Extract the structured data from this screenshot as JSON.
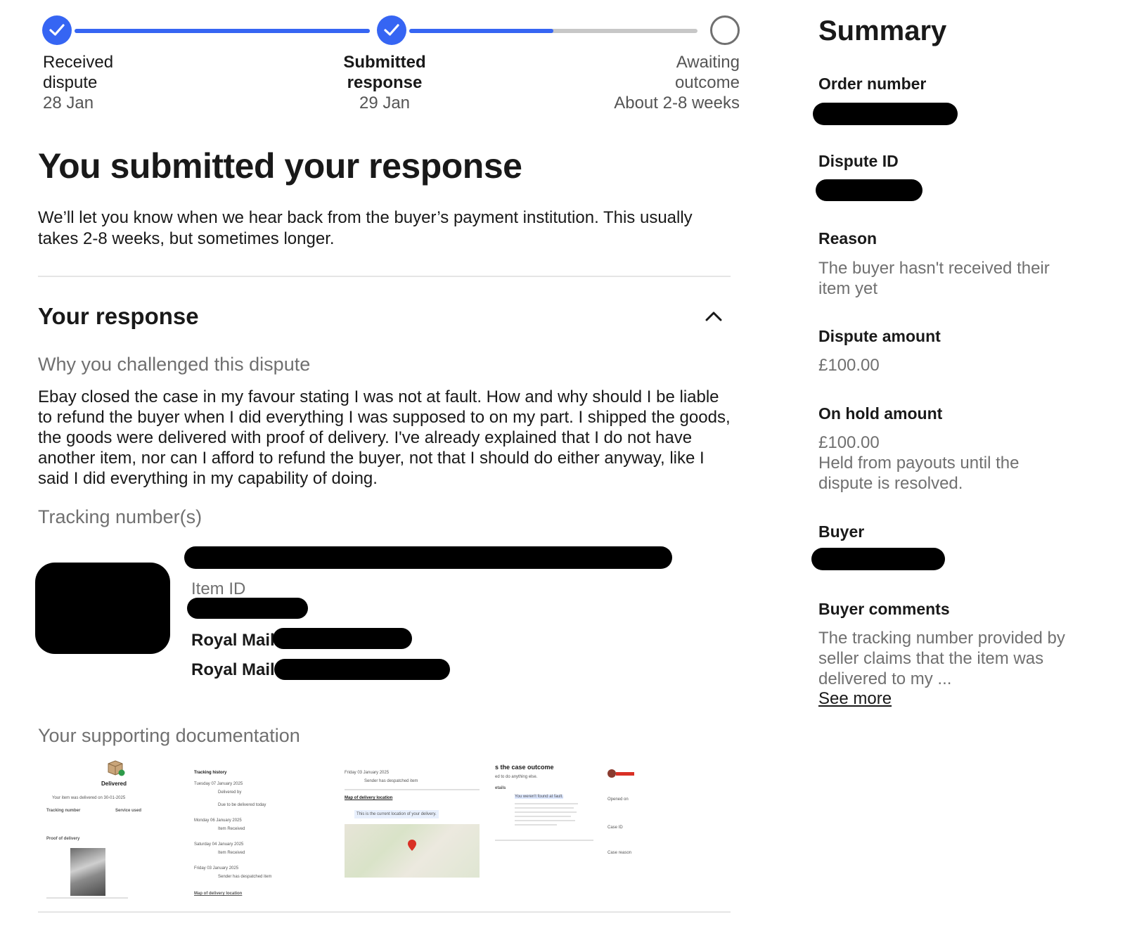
{
  "colors": {
    "accent": "#3665f3",
    "pending": "#707070",
    "redaction": "#000000"
  },
  "stepper": {
    "progress_fraction": 0.5,
    "steps": [
      {
        "name": "Received dispute",
        "date": "28 Jan",
        "state": "done"
      },
      {
        "name": "Submitted response",
        "date": "29 Jan",
        "state": "current"
      },
      {
        "name": "Awaiting outcome",
        "date": "About 2-8 weeks",
        "state": "pending"
      }
    ]
  },
  "main": {
    "title": "You submitted your response",
    "intro": "We’ll let you know when we hear back from the buyer’s payment institution. This usually takes 2-8 weeks, but sometimes longer.",
    "response_section": {
      "title": "Your response",
      "toggle_icon": "chevron-up-icon",
      "why_label": "Why you challenged this dispute",
      "why_text": "Ebay closed the case in my favour stating I was not at fault. How and why should I be liable to refund the buyer when I did everything I was supposed to on my part. I shipped the goods, the goods were delivered with proof of delivery. I've already explained that I do not have another item, nor can I afford to refund the buyer, not that I should do either anyway, like I said I did everything in my capability of doing.",
      "tracking_label": "Tracking number(s)",
      "item_id_label": "Item ID",
      "carriers": [
        "Royal Mail",
        "Royal Mail"
      ],
      "docs_label": "Your supporting documentation",
      "docs": {
        "d1": {
          "status": "Delivered",
          "icon": "parcel-icon",
          "line1": "Your item was delivered on 30-01-2025",
          "tracking": "Tracking number",
          "service": "Service used",
          "proof": "Proof of delivery"
        },
        "d2": {
          "heading": "Tracking history",
          "rows": [
            "Tuesday 07 January 2025",
            "Delivered by",
            "Due to be delivered today",
            "Monday 06 January 2025",
            "Item Received",
            "Saturday 04 January 2025",
            "Item Received",
            "Friday 03 January 2025",
            "Sender has despatched item"
          ],
          "footer": "Map of delivery location"
        },
        "d3": {
          "heading": "Map of delivery location",
          "note": "This is the current location of your delivery.",
          "top": "Friday 03 January 2025",
          "sub": "Sender has despatched item",
          "icon": "map-pin-icon"
        },
        "d4": {
          "heading": "s the case outcome",
          "sub": "ed to do anything else.",
          "label": "etails",
          "highlight": "You weren't found at fault."
        },
        "d5": {
          "label": "Opened on",
          "case": "Case ID",
          "reason": "Case reason"
        }
      }
    }
  },
  "summary": {
    "title": "Summary",
    "order_number_label": "Order number",
    "dispute_id_label": "Dispute ID",
    "reason_label": "Reason",
    "reason_value": "The buyer hasn't received their item yet",
    "dispute_amount_label": "Dispute amount",
    "dispute_amount_value": "£100.00",
    "on_hold_label": "On hold amount",
    "on_hold_value": "£100.00",
    "on_hold_note": "Held from payouts until the dispute is resolved.",
    "buyer_label": "Buyer",
    "buyer_comments_label": "Buyer comments",
    "buyer_comments_value": "The tracking number provided by seller claims that the item was delivered to my ...",
    "see_more": "See more"
  }
}
